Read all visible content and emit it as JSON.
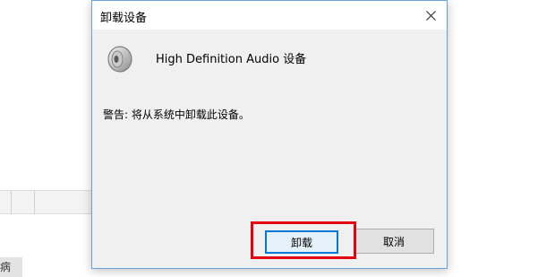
{
  "dialog": {
    "title": "卸载设备",
    "device_name": "High Definition Audio 设备",
    "warning": "警告: 将从系统中卸载此设备。",
    "uninstall_label": "卸载",
    "cancel_label": "取消"
  },
  "background": {
    "chip_text": "病"
  },
  "colors": {
    "highlight": "#e3000f",
    "focus_border": "#0078d7"
  }
}
